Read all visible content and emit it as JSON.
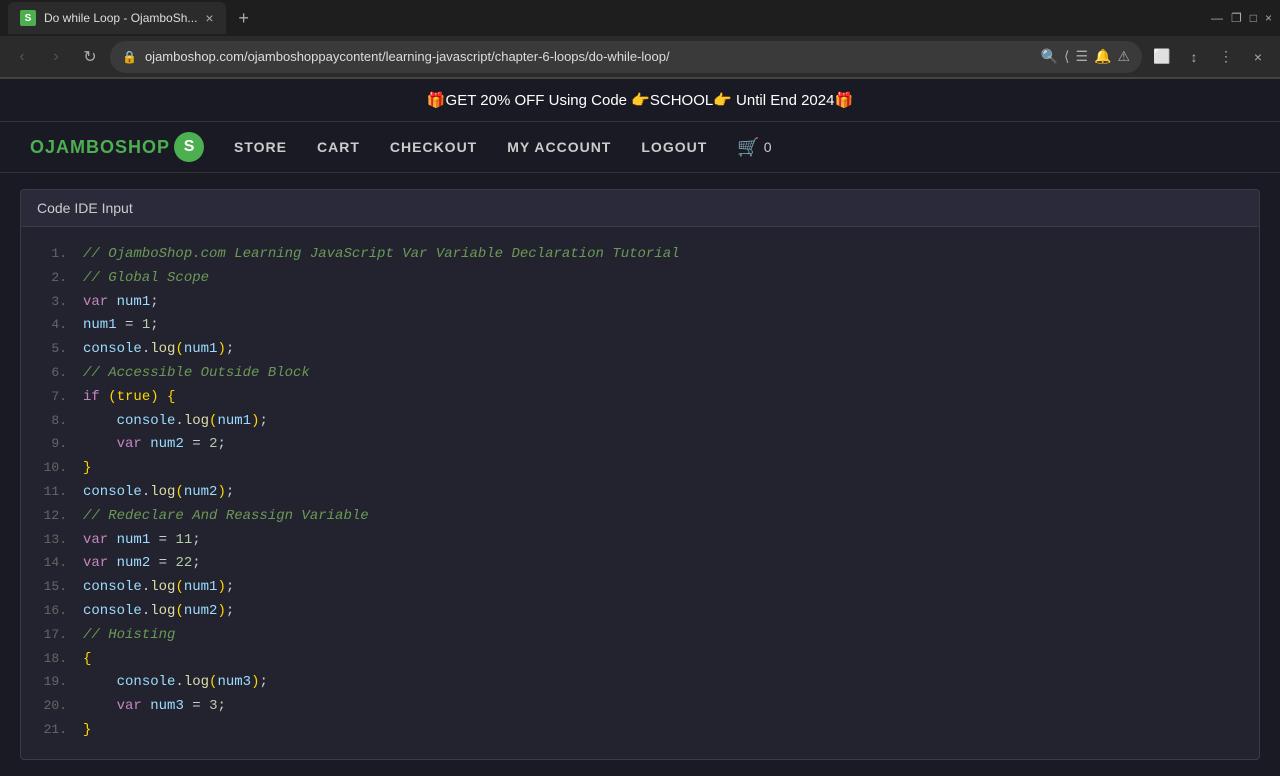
{
  "browser": {
    "tab": {
      "favicon_label": "S",
      "title": "Do while Loop - OjamboSh...",
      "close_label": "×",
      "new_tab_label": "+"
    },
    "controls": {
      "minimize": "—",
      "maximize": "□",
      "restore": "❐",
      "close": "×"
    },
    "nav": {
      "back_label": "‹",
      "forward_label": "›",
      "reload_label": "↻",
      "url": "ojamboshop.com/ojamboshoppaycontent/learning-javascript/chapter-6-loops/do-while-loop/",
      "lock_icon": "🔒"
    }
  },
  "site": {
    "promo_banner": "🎁GET 20% OFF Using Code 👉SCHOOL👉 Until End 2024🎁",
    "nav": {
      "logo_text": "OJAMBOSHOP",
      "logo_icon": "S",
      "links": [
        {
          "label": "STORE",
          "active": false
        },
        {
          "label": "CART",
          "active": false
        },
        {
          "label": "CHECKOUT",
          "active": false
        },
        {
          "label": "MY ACCOUNT",
          "active": false
        },
        {
          "label": "LOGOUT",
          "active": false
        }
      ],
      "cart_icon": "🛒",
      "cart_count": "0"
    }
  },
  "ide": {
    "title": "Code IDE Input",
    "lines": [
      {
        "num": "1.",
        "code": "// OjamboShop.com Learning JavaScript Var Variable Declaration Tutorial",
        "type": "comment"
      },
      {
        "num": "2.",
        "code": "// Global Scope",
        "type": "comment"
      },
      {
        "num": "3.",
        "code": "var num1;",
        "type": "code"
      },
      {
        "num": "4.",
        "code": "num1 = 1;",
        "type": "code"
      },
      {
        "num": "5.",
        "code": "console.log(num1);",
        "type": "code"
      },
      {
        "num": "6.",
        "code": "// Accessible Outside Block",
        "type": "comment"
      },
      {
        "num": "7.",
        "code": "if (true) {",
        "type": "code"
      },
      {
        "num": "8.",
        "code": "    console.log(num1);",
        "type": "code"
      },
      {
        "num": "9.",
        "code": "    var num2 = 2;",
        "type": "code"
      },
      {
        "num": "10.",
        "code": "}",
        "type": "code"
      },
      {
        "num": "11.",
        "code": "console.log(num2);",
        "type": "code"
      },
      {
        "num": "12.",
        "code": "// Redeclare And Reassign Variable",
        "type": "comment"
      },
      {
        "num": "13.",
        "code": "var num1 = 11;",
        "type": "code"
      },
      {
        "num": "14.",
        "code": "var num2 = 22;",
        "type": "code"
      },
      {
        "num": "15.",
        "code": "console.log(num1);",
        "type": "code"
      },
      {
        "num": "16.",
        "code": "console.log(num2);",
        "type": "code"
      },
      {
        "num": "17.",
        "code": "// Hoisting",
        "type": "comment"
      },
      {
        "num": "18.",
        "code": "{",
        "type": "code"
      },
      {
        "num": "19.",
        "code": "    console.log(num3);",
        "type": "code"
      },
      {
        "num": "20.",
        "code": "    var num3 = 3;",
        "type": "code"
      },
      {
        "num": "21.",
        "code": "}",
        "type": "code"
      }
    ]
  }
}
